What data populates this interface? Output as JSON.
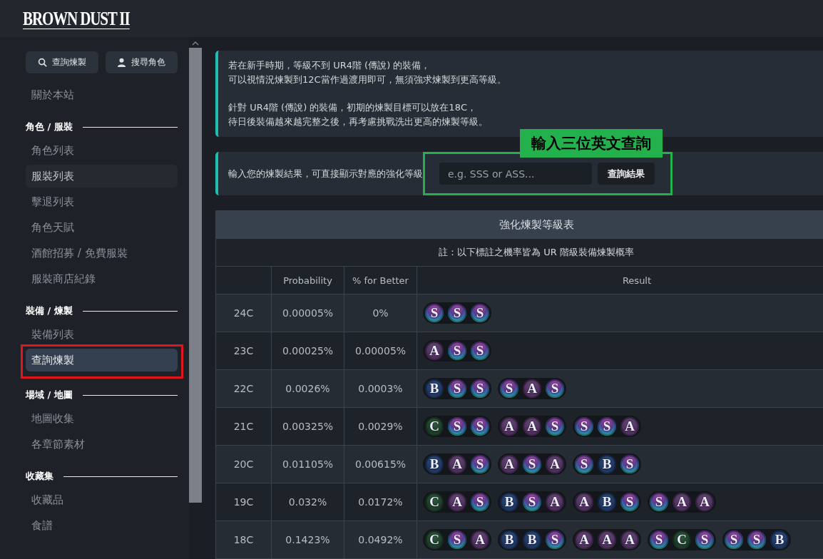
{
  "header": {
    "logo": "BROWN DUST II"
  },
  "sidebar": {
    "buttons": [
      {
        "label": "查詢煉製"
      },
      {
        "label": "搜尋角色"
      }
    ],
    "sections": [
      {
        "items": [
          {
            "label": "關於本站",
            "selected": false,
            "hovered": false,
            "circled": false
          }
        ]
      },
      {
        "title": "角色 / 服裝",
        "items": [
          {
            "label": "角色列表",
            "selected": false,
            "hovered": false,
            "circled": false
          },
          {
            "label": "服裝列表",
            "selected": false,
            "hovered": true,
            "circled": false
          },
          {
            "label": "擊退列表",
            "selected": false,
            "hovered": false,
            "circled": false
          },
          {
            "label": "角色天賦",
            "selected": false,
            "hovered": false,
            "circled": false
          },
          {
            "label": "酒館招募 / 免費服裝",
            "selected": false,
            "hovered": false,
            "circled": false
          },
          {
            "label": "服裝商店紀錄",
            "selected": false,
            "hovered": false,
            "circled": false
          }
        ]
      },
      {
        "title": "裝備 / 煉製",
        "items": [
          {
            "label": "裝備列表",
            "selected": false,
            "hovered": false,
            "circled": false
          },
          {
            "label": "查詢煉製",
            "selected": true,
            "hovered": false,
            "circled": true
          }
        ]
      },
      {
        "title": "場域 / 地圖",
        "items": [
          {
            "label": "地圖收集",
            "selected": false,
            "hovered": false,
            "circled": false
          },
          {
            "label": "各章節素材",
            "selected": false,
            "hovered": false,
            "circled": false
          }
        ]
      },
      {
        "title": "收藏集",
        "items": [
          {
            "label": "收藏品",
            "selected": false,
            "hovered": false,
            "circled": false
          },
          {
            "label": "食譜",
            "selected": false,
            "hovered": false,
            "circled": false
          }
        ]
      }
    ]
  },
  "info": {
    "paragraphs": [
      [
        "若在新手時期，等級不到 UR4階 (傳說) 的裝備，",
        "可以視情況煉製到12C當作過渡用即可，無須強求煉製到更高等級。"
      ],
      [
        "針對 UR4階 (傳說) 的裝備，初期的煉製目標可以放在18C，",
        "待日後裝備越來越完整之後，再考慮挑戰洗出更高的煉製等級。"
      ]
    ]
  },
  "query": {
    "label": "輸入您的煉製結果，可直接顯示對應的強化等級",
    "placeholder": "e.g. SSS or ASS...",
    "button": "查詢結果"
  },
  "annotations": {
    "green_label": "輸入三位英文查詢"
  },
  "table": {
    "title": "強化煉製等級表",
    "note": "註：以下標註之機率皆為 UR 階級裝備煉製概率",
    "columns": [
      "",
      "Probability",
      "% for Better",
      "Result"
    ],
    "rows": [
      {
        "level": "24C",
        "probability": "0.00005%",
        "better": "0%",
        "results": [
          [
            {
              "letter": "S",
              "kind": "rainbow"
            },
            {
              "letter": "S",
              "kind": "rainbow"
            },
            {
              "letter": "S",
              "kind": "rainbow"
            }
          ]
        ]
      },
      {
        "level": "23C",
        "probability": "0.00025%",
        "better": "0.00005%",
        "results": [
          [
            {
              "letter": "A",
              "kind": "purple"
            },
            {
              "letter": "S",
              "kind": "rainbow"
            },
            {
              "letter": "S",
              "kind": "rainbow"
            }
          ]
        ]
      },
      {
        "level": "22C",
        "probability": "0.0026%",
        "better": "0.0003%",
        "results": [
          [
            {
              "letter": "B",
              "kind": "blue"
            },
            {
              "letter": "S",
              "kind": "rainbow"
            },
            {
              "letter": "S",
              "kind": "rainbow"
            }
          ],
          [
            {
              "letter": "S",
              "kind": "rainbow"
            },
            {
              "letter": "A",
              "kind": "purple"
            },
            {
              "letter": "S",
              "kind": "rainbow"
            }
          ]
        ]
      },
      {
        "level": "21C",
        "probability": "0.00325%",
        "better": "0.0029%",
        "results": [
          [
            {
              "letter": "C",
              "kind": "green"
            },
            {
              "letter": "S",
              "kind": "rainbow"
            },
            {
              "letter": "S",
              "kind": "rainbow"
            }
          ],
          [
            {
              "letter": "A",
              "kind": "purple"
            },
            {
              "letter": "A",
              "kind": "purple"
            },
            {
              "letter": "S",
              "kind": "rainbow"
            }
          ],
          [
            {
              "letter": "S",
              "kind": "rainbow"
            },
            {
              "letter": "S",
              "kind": "rainbow"
            },
            {
              "letter": "A",
              "kind": "purple"
            }
          ]
        ]
      },
      {
        "level": "20C",
        "probability": "0.01105%",
        "better": "0.00615%",
        "results": [
          [
            {
              "letter": "B",
              "kind": "blue"
            },
            {
              "letter": "A",
              "kind": "purple"
            },
            {
              "letter": "S",
              "kind": "rainbow"
            }
          ],
          [
            {
              "letter": "A",
              "kind": "purple"
            },
            {
              "letter": "S",
              "kind": "rainbow"
            },
            {
              "letter": "A",
              "kind": "purple"
            }
          ],
          [
            {
              "letter": "S",
              "kind": "rainbow"
            },
            {
              "letter": "B",
              "kind": "blue"
            },
            {
              "letter": "S",
              "kind": "rainbow"
            }
          ]
        ]
      },
      {
        "level": "19C",
        "probability": "0.032%",
        "better": "0.0172%",
        "results": [
          [
            {
              "letter": "C",
              "kind": "green"
            },
            {
              "letter": "A",
              "kind": "purple"
            },
            {
              "letter": "S",
              "kind": "rainbow"
            }
          ],
          [
            {
              "letter": "B",
              "kind": "blue"
            },
            {
              "letter": "S",
              "kind": "rainbow"
            },
            {
              "letter": "A",
              "kind": "purple"
            }
          ],
          [
            {
              "letter": "A",
              "kind": "purple"
            },
            {
              "letter": "B",
              "kind": "blue"
            },
            {
              "letter": "S",
              "kind": "rainbow"
            }
          ],
          [
            {
              "letter": "S",
              "kind": "rainbow"
            },
            {
              "letter": "A",
              "kind": "purple"
            },
            {
              "letter": "A",
              "kind": "purple"
            }
          ]
        ]
      },
      {
        "level": "18C",
        "probability": "0.1423%",
        "better": "0.0492%",
        "results": [
          [
            {
              "letter": "C",
              "kind": "green"
            },
            {
              "letter": "S",
              "kind": "rainbow"
            },
            {
              "letter": "A",
              "kind": "purple"
            }
          ],
          [
            {
              "letter": "B",
              "kind": "blue"
            },
            {
              "letter": "B",
              "kind": "blue"
            },
            {
              "letter": "S",
              "kind": "rainbow"
            }
          ],
          [
            {
              "letter": "A",
              "kind": "purple"
            },
            {
              "letter": "A",
              "kind": "purple"
            },
            {
              "letter": "A",
              "kind": "purple"
            }
          ],
          [
            {
              "letter": "S",
              "kind": "rainbow"
            },
            {
              "letter": "C",
              "kind": "green"
            },
            {
              "letter": "S",
              "kind": "rainbow"
            }
          ],
          [
            {
              "letter": "S",
              "kind": "rainbow"
            },
            {
              "letter": "S",
              "kind": "rainbow"
            },
            {
              "letter": "B",
              "kind": "blue"
            }
          ]
        ]
      }
    ]
  }
}
